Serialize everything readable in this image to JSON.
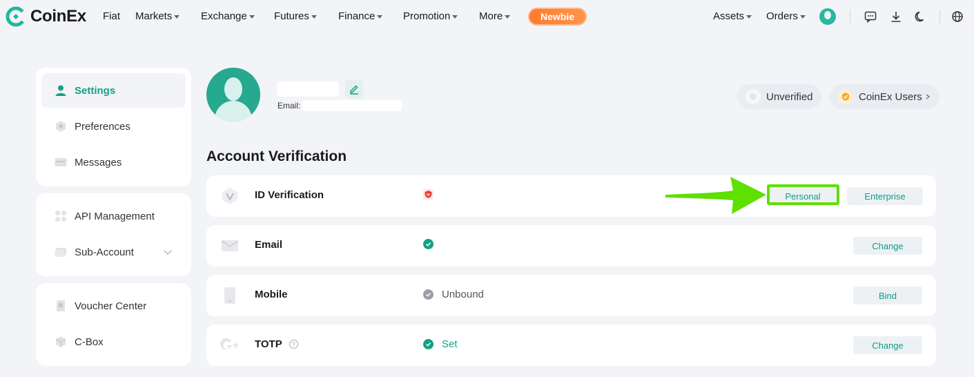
{
  "brand": {
    "name": "CoinEx",
    "accent": "#16a085"
  },
  "nav": {
    "items": [
      {
        "label": "Fiat",
        "dropdown": false
      },
      {
        "label": "Markets",
        "dropdown": true
      },
      {
        "label": "Exchange",
        "dropdown": true
      },
      {
        "label": "Futures",
        "dropdown": true
      },
      {
        "label": "Finance",
        "dropdown": true
      },
      {
        "label": "Promotion",
        "dropdown": true
      },
      {
        "label": "More",
        "dropdown": true
      }
    ],
    "newbie": "Newbie",
    "assets": "Assets",
    "orders": "Orders",
    "icons": [
      "chat-icon",
      "download-icon",
      "moon-icon",
      "globe-icon"
    ]
  },
  "sidebar": {
    "group1": [
      {
        "label": "Settings",
        "icon": "user-icon",
        "active": true
      },
      {
        "label": "Preferences",
        "icon": "preferences-icon",
        "active": false
      },
      {
        "label": "Messages",
        "icon": "messages-icon",
        "active": false
      }
    ],
    "group2": [
      {
        "label": "API Management",
        "icon": "api-icon",
        "active": false
      },
      {
        "label": "Sub-Account",
        "icon": "sub-account-icon",
        "active": false
      }
    ],
    "group3": [
      {
        "label": "Voucher Center",
        "icon": "voucher-icon",
        "active": false
      },
      {
        "label": "C-Box",
        "icon": "cbox-icon",
        "active": false
      }
    ]
  },
  "profile": {
    "email_label": "Email:",
    "badges": {
      "unverified": "Unverified",
      "level": "CoinEx Users"
    }
  },
  "verification": {
    "title": "Account Verification",
    "rows": [
      {
        "label": "ID Verification",
        "status_text": "",
        "status": "failed",
        "buttons": [
          "Personal",
          "Enterprise"
        ]
      },
      {
        "label": "Email",
        "status_text": "",
        "status": "verified",
        "buttons": [
          "Change"
        ]
      },
      {
        "label": "Mobile",
        "status_text": "Unbound",
        "status": "unbound",
        "buttons": [
          "Bind"
        ]
      },
      {
        "label": "TOTP",
        "status_text": "Set",
        "status": "verified",
        "buttons": [
          "Change"
        ]
      }
    ]
  }
}
